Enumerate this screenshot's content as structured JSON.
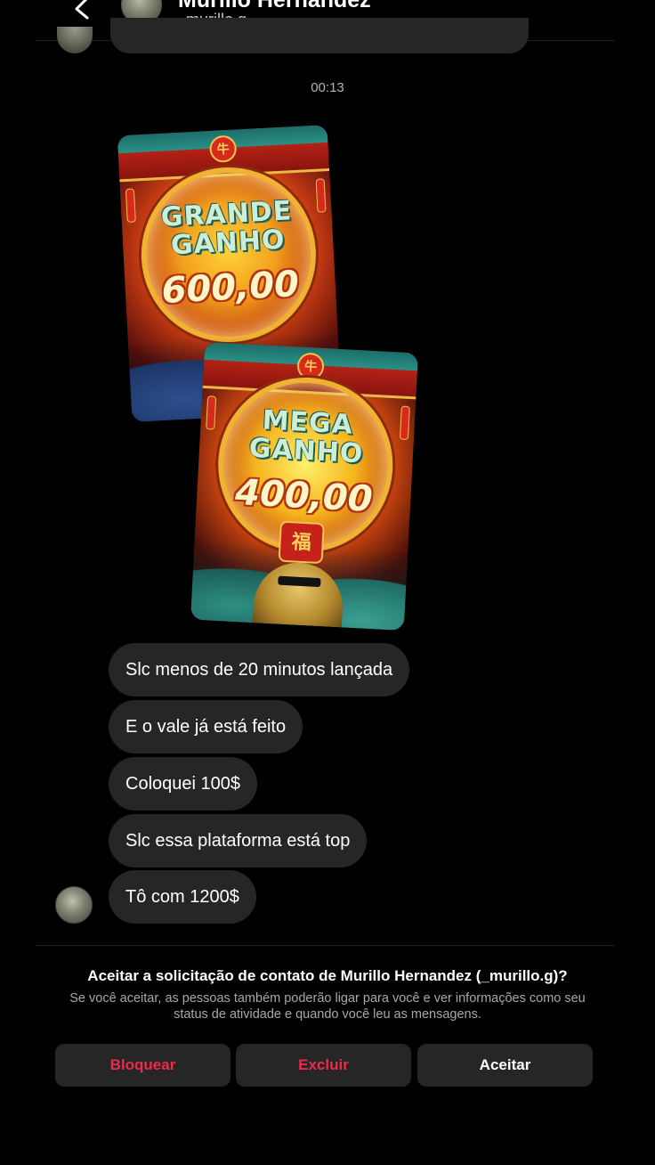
{
  "header": {
    "name": "Murillo Hernandez",
    "username": "_murillo.g"
  },
  "timestamp": "00:13",
  "cards": [
    {
      "title_line1": "GRANDE",
      "title_line2": "GANHO",
      "amount": "600,00"
    },
    {
      "title_line1": "MEGA",
      "title_line2": "GANHO",
      "amount": "400,00"
    }
  ],
  "messages": [
    "Slc menos de 20 minutos lançada",
    "E o vale já está feito",
    "Coloquei 100$",
    "Slc essa plataforma está top",
    "Tô com 1200$"
  ],
  "request": {
    "title": "Aceitar a solicitação de contato de Murillo Hernandez (_murillo.g)?",
    "description": "Se você aceitar, as pessoas também poderão ligar para você e ver informações como seu status de atividade e quando você leu as mensagens."
  },
  "actions": {
    "block": "Bloquear",
    "delete": "Excluir",
    "accept": "Aceitar"
  },
  "colors": {
    "background": "#000000",
    "bubble": "#262626",
    "danger": "#ec2a4c"
  }
}
